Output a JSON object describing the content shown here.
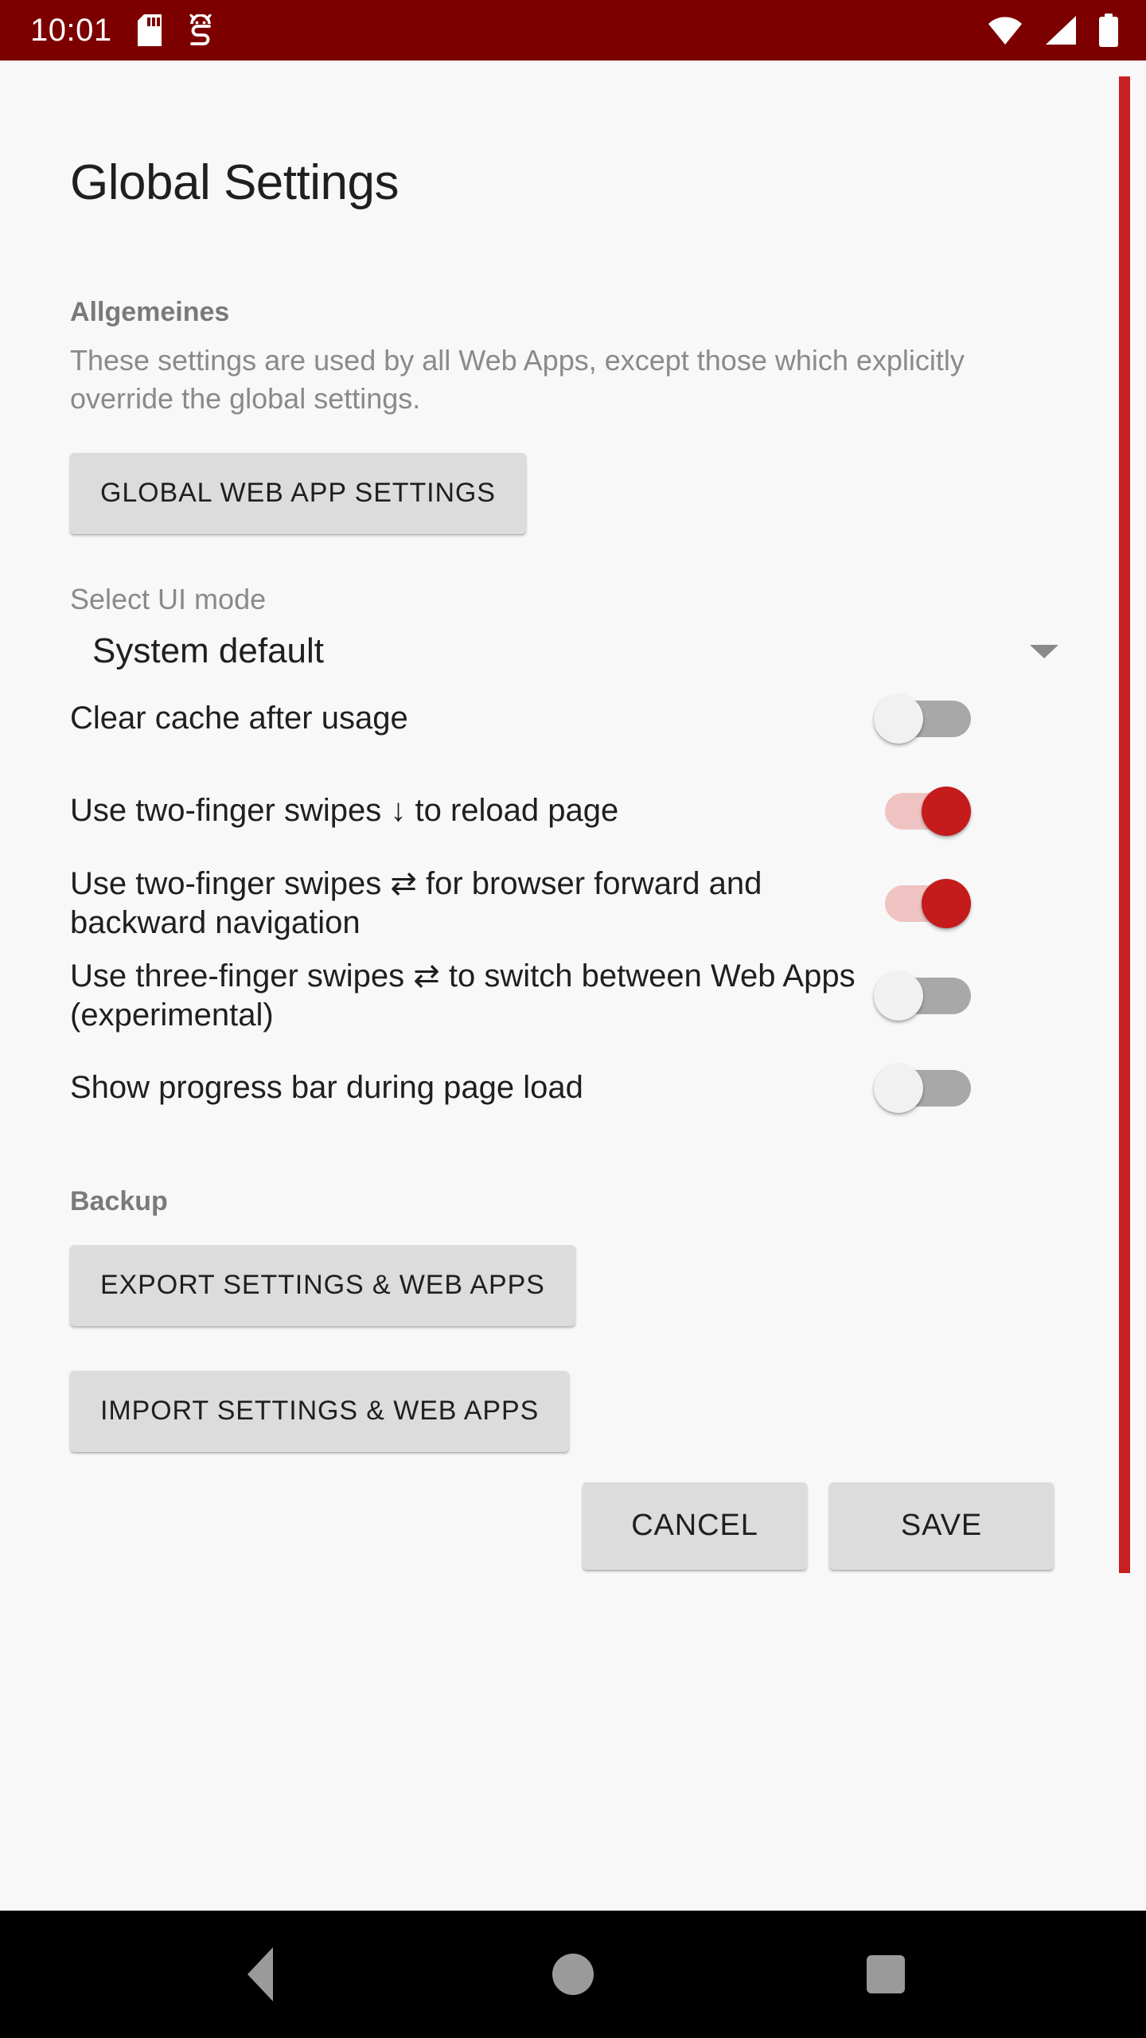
{
  "status_bar": {
    "time": "10:01",
    "background_color": "#7d0000",
    "left_icons": [
      {
        "name": "sd-card-icon"
      },
      {
        "name": "android-debug-bug-icon"
      }
    ],
    "right_icons": [
      {
        "name": "wifi-icon"
      },
      {
        "name": "cellular-signal-icon"
      },
      {
        "name": "battery-full-icon"
      }
    ]
  },
  "screen": {
    "title": "Global Settings",
    "background_color": "#f8f8f8",
    "accent_color": "#c62020"
  },
  "general_section": {
    "header": "Allgemeines",
    "description": "These settings are used by all Web Apps, except those which explicitly override the global settings.",
    "global_web_app_settings_button": "GLOBAL WEB APP SETTINGS",
    "ui_mode": {
      "label": "Select UI mode",
      "value": "System default",
      "caret_icon": "chevron-down-icon"
    },
    "switches": [
      {
        "label": "Clear cache after usage",
        "state": "off",
        "name": "clear-cache-after-usage"
      },
      {
        "label": "Use two-finger swipes ↓ to reload page",
        "state": "on",
        "name": "two-finger-swipe-reload"
      },
      {
        "label": "Use two-finger swipes ⇄ for browser forward and backward navigation",
        "state": "on",
        "name": "two-finger-swipe-navigation"
      },
      {
        "label": "Use three-finger swipes ⇄ to switch between Web Apps (experimental)",
        "state": "off",
        "name": "three-finger-swipe-switch-apps"
      },
      {
        "label": "Show progress bar during page load",
        "state": "off",
        "name": "show-progress-bar"
      }
    ]
  },
  "backup_section": {
    "header": "Backup",
    "export_button": "EXPORT SETTINGS & WEB APPS",
    "import_button": "IMPORT SETTINGS & WEB APPS"
  },
  "actions": {
    "cancel_button": "CANCEL",
    "save_button": "SAVE"
  },
  "nav_bar": {
    "background_color": "#000000",
    "buttons": [
      {
        "name": "nav-back-icon"
      },
      {
        "name": "nav-home-icon"
      },
      {
        "name": "nav-recents-icon"
      }
    ]
  }
}
